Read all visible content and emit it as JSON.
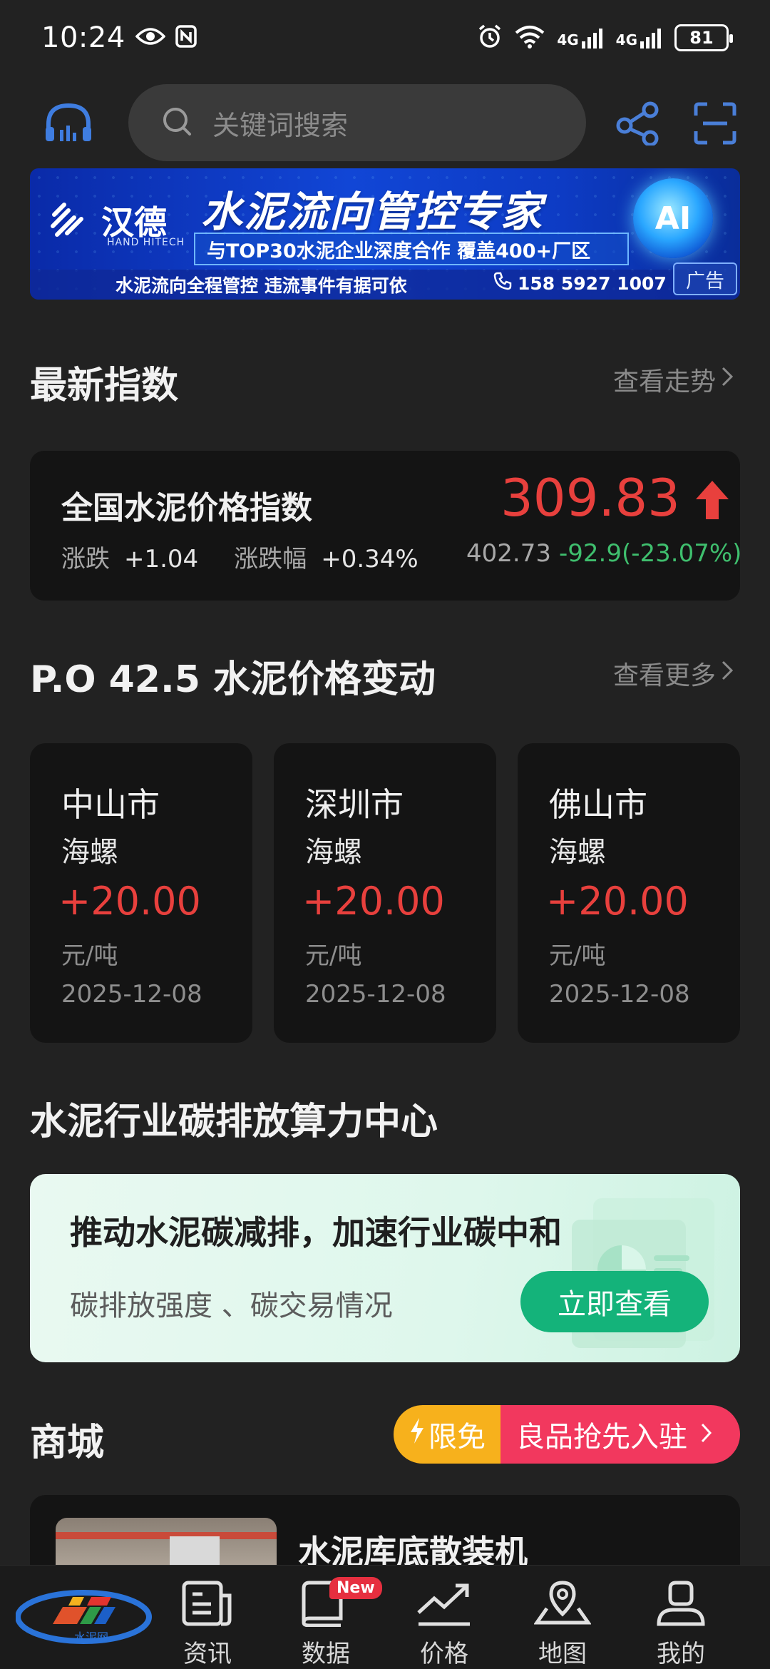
{
  "status_bar": {
    "time": "10:24",
    "net1": "4G",
    "net2": "4G",
    "battery": "81"
  },
  "header": {
    "search_placeholder": "关键词搜索"
  },
  "ad": {
    "brand_cn": "汉德",
    "brand_en": "HAND HITECH",
    "headline": "水泥流向管控专家",
    "subline": "与TOP30水泥企业深度合作  覆盖400+厂区",
    "ai": "AI",
    "bottom": "水泥流向全程管控  违流事件有据可依",
    "phone": "158 5927 1007",
    "tag": "广告"
  },
  "index_section": {
    "title": "最新指数",
    "more": "查看走势",
    "card": {
      "name": "全国水泥价格指数",
      "value": "309.83",
      "change_label": "涨跌",
      "change_value": "+1.04",
      "pct_label": "涨跌幅",
      "pct_value": "+0.34%",
      "prev_value": "402.73",
      "delta": "-92.9(-23.07%)"
    }
  },
  "price_section": {
    "title": "P.O 42.5 水泥价格变动",
    "more": "查看更多",
    "cards": [
      {
        "city": "中山市",
        "brand": "海螺",
        "change": "+20.00",
        "unit": "元/吨",
        "date": "2025-12-08"
      },
      {
        "city": "深圳市",
        "brand": "海螺",
        "change": "+20.00",
        "unit": "元/吨",
        "date": "2025-12-08"
      },
      {
        "city": "佛山市",
        "brand": "海螺",
        "change": "+20.00",
        "unit": "元/吨",
        "date": "2025-12-08"
      }
    ]
  },
  "carbon_section": {
    "title": "水泥行业碳排放算力中心",
    "card_title": "推动水泥碳减排，加速行业碳中和",
    "card_sub": "碳排放强度 、碳交易情况",
    "button": "立即查看"
  },
  "mall_section": {
    "title": "商城",
    "free_label": "限免",
    "promo_label": "良品抢先入驻",
    "product_name": "水泥库底散装机"
  },
  "bottom_nav": {
    "logo_text": "水泥网",
    "items": [
      {
        "label": "资讯"
      },
      {
        "label": "数据",
        "badge": "New"
      },
      {
        "label": "价格"
      },
      {
        "label": "地图"
      },
      {
        "label": "我的"
      }
    ]
  },
  "colors": {
    "up_red": "#e8403d",
    "down_green": "#3fbf6e",
    "accent_green": "#14b37a",
    "badge_yellow": "#f7b11c",
    "badge_pink": "#f2385e"
  }
}
